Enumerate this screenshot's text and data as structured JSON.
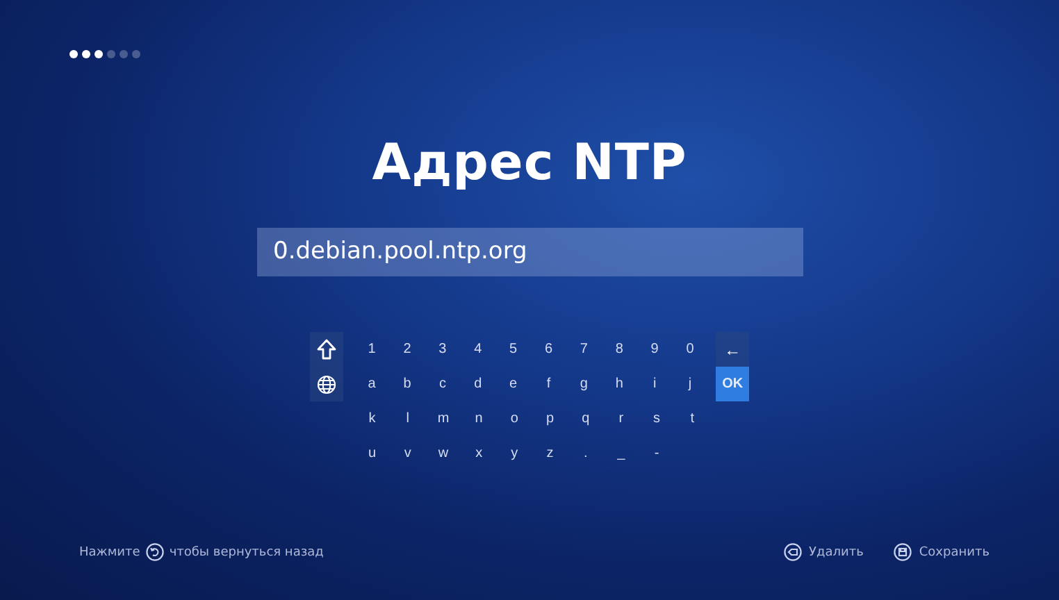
{
  "steps": [
    {
      "active": true
    },
    {
      "active": true
    },
    {
      "active": true
    },
    {
      "active": false
    },
    {
      "active": false
    },
    {
      "active": false
    }
  ],
  "title": "Адрес NTP",
  "address_field": {
    "value": "0.debian.pool.ntp.org"
  },
  "keyboard": {
    "rows": [
      [
        {
          "kind": "shift",
          "selected": false
        },
        {
          "kind": "char",
          "label": "1",
          "selected": false
        },
        {
          "kind": "char",
          "label": "2",
          "selected": false
        },
        {
          "kind": "char",
          "label": "3",
          "selected": false
        },
        {
          "kind": "char",
          "label": "4",
          "selected": false
        },
        {
          "kind": "char",
          "label": "5",
          "selected": false
        },
        {
          "kind": "char",
          "label": "6",
          "selected": false
        },
        {
          "kind": "char",
          "label": "7",
          "selected": false
        },
        {
          "kind": "char",
          "label": "8",
          "selected": false
        },
        {
          "kind": "char",
          "label": "9",
          "selected": false
        },
        {
          "kind": "char",
          "label": "0",
          "selected": false
        },
        {
          "kind": "action",
          "label": "←",
          "selected": false
        }
      ],
      [
        {
          "kind": "globe",
          "selected": false
        },
        {
          "kind": "char",
          "label": "a",
          "selected": false
        },
        {
          "kind": "char",
          "label": "b",
          "selected": false
        },
        {
          "kind": "char",
          "label": "c",
          "selected": false
        },
        {
          "kind": "char",
          "label": "d",
          "selected": false
        },
        {
          "kind": "char",
          "label": "e",
          "selected": false
        },
        {
          "kind": "char",
          "label": "f",
          "selected": false
        },
        {
          "kind": "char",
          "label": "g",
          "selected": false
        },
        {
          "kind": "char",
          "label": "h",
          "selected": false
        },
        {
          "kind": "char",
          "label": "i",
          "selected": false
        },
        {
          "kind": "char",
          "label": "j",
          "selected": false
        },
        {
          "kind": "action",
          "label": "OK",
          "selected": true
        }
      ],
      [
        {
          "kind": "char",
          "label": "k",
          "selected": false
        },
        {
          "kind": "char",
          "label": "l",
          "selected": false
        },
        {
          "kind": "char",
          "label": "m",
          "selected": false
        },
        {
          "kind": "char",
          "label": "n",
          "selected": false
        },
        {
          "kind": "char",
          "label": "o",
          "selected": false
        },
        {
          "kind": "char",
          "label": "p",
          "selected": false
        },
        {
          "kind": "char",
          "label": "q",
          "selected": false
        },
        {
          "kind": "char",
          "label": "r",
          "selected": false
        },
        {
          "kind": "char",
          "label": "s",
          "selected": false
        },
        {
          "kind": "char",
          "label": "t",
          "selected": false
        }
      ],
      [
        {
          "kind": "char",
          "label": "u",
          "selected": false
        },
        {
          "kind": "char",
          "label": "v",
          "selected": false
        },
        {
          "kind": "char",
          "label": "w",
          "selected": false
        },
        {
          "kind": "char",
          "label": "x",
          "selected": false
        },
        {
          "kind": "char",
          "label": "y",
          "selected": false
        },
        {
          "kind": "char",
          "label": "z",
          "selected": false
        },
        {
          "kind": "char",
          "label": ".",
          "selected": false
        },
        {
          "kind": "char",
          "label": "_",
          "selected": false
        },
        {
          "kind": "char",
          "label": "-",
          "selected": false
        }
      ]
    ]
  },
  "footer": {
    "hint_before": "Нажмите",
    "hint_after": "чтобы вернуться назад",
    "actions": [
      {
        "kind": "delete",
        "label": "Удалить"
      },
      {
        "kind": "save",
        "label": "Сохранить"
      }
    ]
  }
}
